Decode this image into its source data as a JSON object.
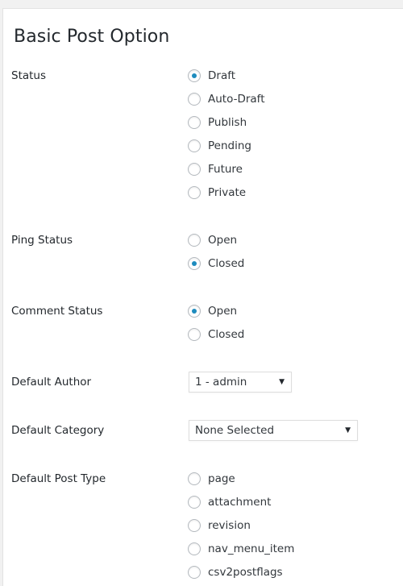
{
  "title": "Basic Post Option",
  "fields": {
    "status": {
      "label": "Status",
      "options": [
        "Draft",
        "Auto-Draft",
        "Publish",
        "Pending",
        "Future",
        "Private"
      ],
      "selected": "Draft"
    },
    "ping_status": {
      "label": "Ping Status",
      "options": [
        "Open",
        "Closed"
      ],
      "selected": "Closed"
    },
    "comment_status": {
      "label": "Comment Status",
      "options": [
        "Open",
        "Closed"
      ],
      "selected": "Open"
    },
    "default_author": {
      "label": "Default Author",
      "value": "1 - admin",
      "caret_icon": "caret-down-icon"
    },
    "default_category": {
      "label": "Default Category",
      "value": "None Selected",
      "caret_icon": "caret-down-icon"
    },
    "default_post_type": {
      "label": "Default Post Type",
      "options": [
        "page",
        "attachment",
        "revision",
        "nav_menu_item",
        "csv2postflags"
      ],
      "selected": null
    }
  },
  "colors": {
    "accent": "#1e8cbe",
    "background": "#f1f1f1",
    "card": "#ffffff"
  }
}
